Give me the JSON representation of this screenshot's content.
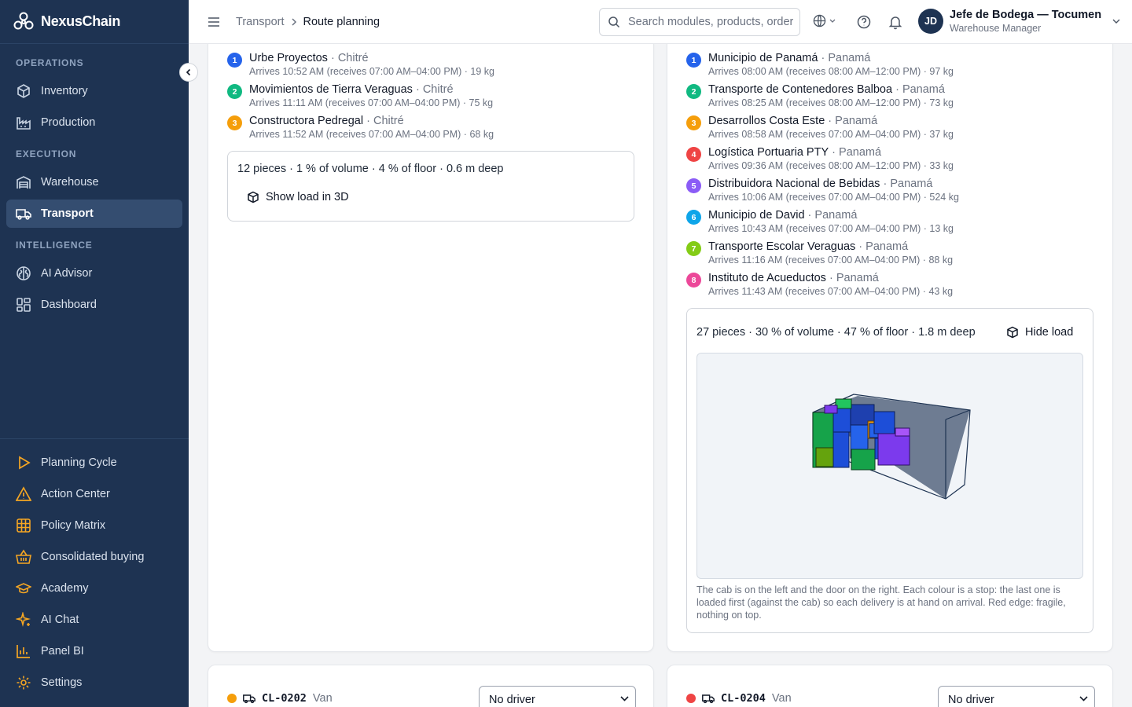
{
  "app": {
    "name": "NexusChain"
  },
  "sidebar": {
    "sections": [
      {
        "label": "OPERATIONS",
        "items": [
          {
            "label": "Inventory",
            "icon": "box-icon"
          },
          {
            "label": "Production",
            "icon": "factory-icon"
          }
        ]
      },
      {
        "label": "EXECUTION",
        "items": [
          {
            "label": "Warehouse",
            "icon": "warehouse-icon"
          },
          {
            "label": "Transport",
            "icon": "truck-icon",
            "active": true
          }
        ]
      },
      {
        "label": "INTELLIGENCE",
        "items": [
          {
            "label": "AI Advisor",
            "icon": "brain-icon"
          },
          {
            "label": "Dashboard",
            "icon": "dashboard-icon"
          }
        ]
      }
    ],
    "bottom_items": [
      {
        "label": "Planning Cycle",
        "icon": "play-icon"
      },
      {
        "label": "Action Center",
        "icon": "alert-triangle-icon"
      },
      {
        "label": "Policy Matrix",
        "icon": "grid-icon"
      },
      {
        "label": "Consolidated buying",
        "icon": "basket-icon"
      },
      {
        "label": "Academy",
        "icon": "graduation-cap-icon"
      },
      {
        "label": "AI Chat",
        "icon": "sparkles-icon"
      },
      {
        "label": "Panel BI",
        "icon": "bar-chart-icon"
      },
      {
        "label": "Settings",
        "icon": "gear-icon"
      }
    ],
    "accent_icon_color": "#f5a623"
  },
  "header": {
    "breadcrumb": {
      "parent": "Transport",
      "current": "Route planning"
    },
    "search_placeholder": "Search modules, products, orders",
    "user": {
      "initials": "JD",
      "name": "Jefe de Bodega — Tocumen",
      "role": "Warehouse Manager"
    }
  },
  "routes": [
    {
      "stops": [
        {
          "n": "1",
          "name": "Urbe Proyectos",
          "city": "Chitré",
          "detail": "Arrives 10:52 AM (receives 07:00 AM–04:00 PM) · 19 kg",
          "color": "#2563eb"
        },
        {
          "n": "2",
          "name": "Movimientos de Tierra Veraguas",
          "city": "Chitré",
          "detail": "Arrives 11:11 AM (receives 07:00 AM–04:00 PM) · 75 kg",
          "color": "#10b981"
        },
        {
          "n": "3",
          "name": "Constructora Pedregal",
          "city": "Chitré",
          "detail": "Arrives 11:52 AM (receives 07:00 AM–04:00 PM) · 68 kg",
          "color": "#f59e0b"
        }
      ],
      "load_summary": "12 pieces · 1 % of volume · 4 % of floor · 0.6 m deep",
      "load_button": "Show load in 3D"
    },
    {
      "stops": [
        {
          "n": "1",
          "name": "Municipio de Panamá",
          "city": "Panamá",
          "detail": "Arrives 08:00 AM (receives 08:00 AM–12:00 PM) · 97 kg",
          "color": "#2563eb"
        },
        {
          "n": "2",
          "name": "Transporte de Contenedores Balboa",
          "city": "Panamá",
          "detail": "Arrives 08:25 AM (receives 08:00 AM–12:00 PM) · 73 kg",
          "color": "#10b981"
        },
        {
          "n": "3",
          "name": "Desarrollos Costa Este",
          "city": "Panamá",
          "detail": "Arrives 08:58 AM (receives 07:00 AM–04:00 PM) · 37 kg",
          "color": "#f59e0b"
        },
        {
          "n": "4",
          "name": "Logística Portuaria PTY",
          "city": "Panamá",
          "detail": "Arrives 09:36 AM (receives 08:00 AM–12:00 PM) · 33 kg",
          "color": "#ef4444"
        },
        {
          "n": "5",
          "name": "Distribuidora Nacional de Bebidas",
          "city": "Panamá",
          "detail": "Arrives 10:06 AM (receives 07:00 AM–04:00 PM) · 524 kg",
          "color": "#8b5cf6"
        },
        {
          "n": "6",
          "name": "Municipio de David",
          "city": "Panamá",
          "detail": "Arrives 10:43 AM (receives 07:00 AM–04:00 PM) · 13 kg",
          "color": "#0ea5e9"
        },
        {
          "n": "7",
          "name": "Transporte Escolar Veraguas",
          "city": "Panamá",
          "detail": "Arrives 11:16 AM (receives 07:00 AM–04:00 PM) · 88 kg",
          "color": "#84cc16"
        },
        {
          "n": "8",
          "name": "Instituto de Acueductos",
          "city": "Panamá",
          "detail": "Arrives 11:43 AM (receives 07:00 AM–04:00 PM) · 43 kg",
          "color": "#ec4899"
        }
      ],
      "load_summary": "27 pieces · 30 % of volume · 47 % of floor · 1.8 m deep",
      "load_button": "Hide load",
      "caption": "The cab is on the left and the door on the right. Each colour is a stop: the last one is loaded first (against the cab) so each delivery is at hand on arrival. Red edge: fragile, nothing on top."
    }
  ],
  "vehicles": [
    {
      "code": "CL-0202",
      "type": "Van",
      "status_color": "#f59e0b",
      "driver": "No driver"
    },
    {
      "code": "CL-0204",
      "type": "Van",
      "status_color": "#ef4444",
      "driver": "No driver"
    }
  ]
}
